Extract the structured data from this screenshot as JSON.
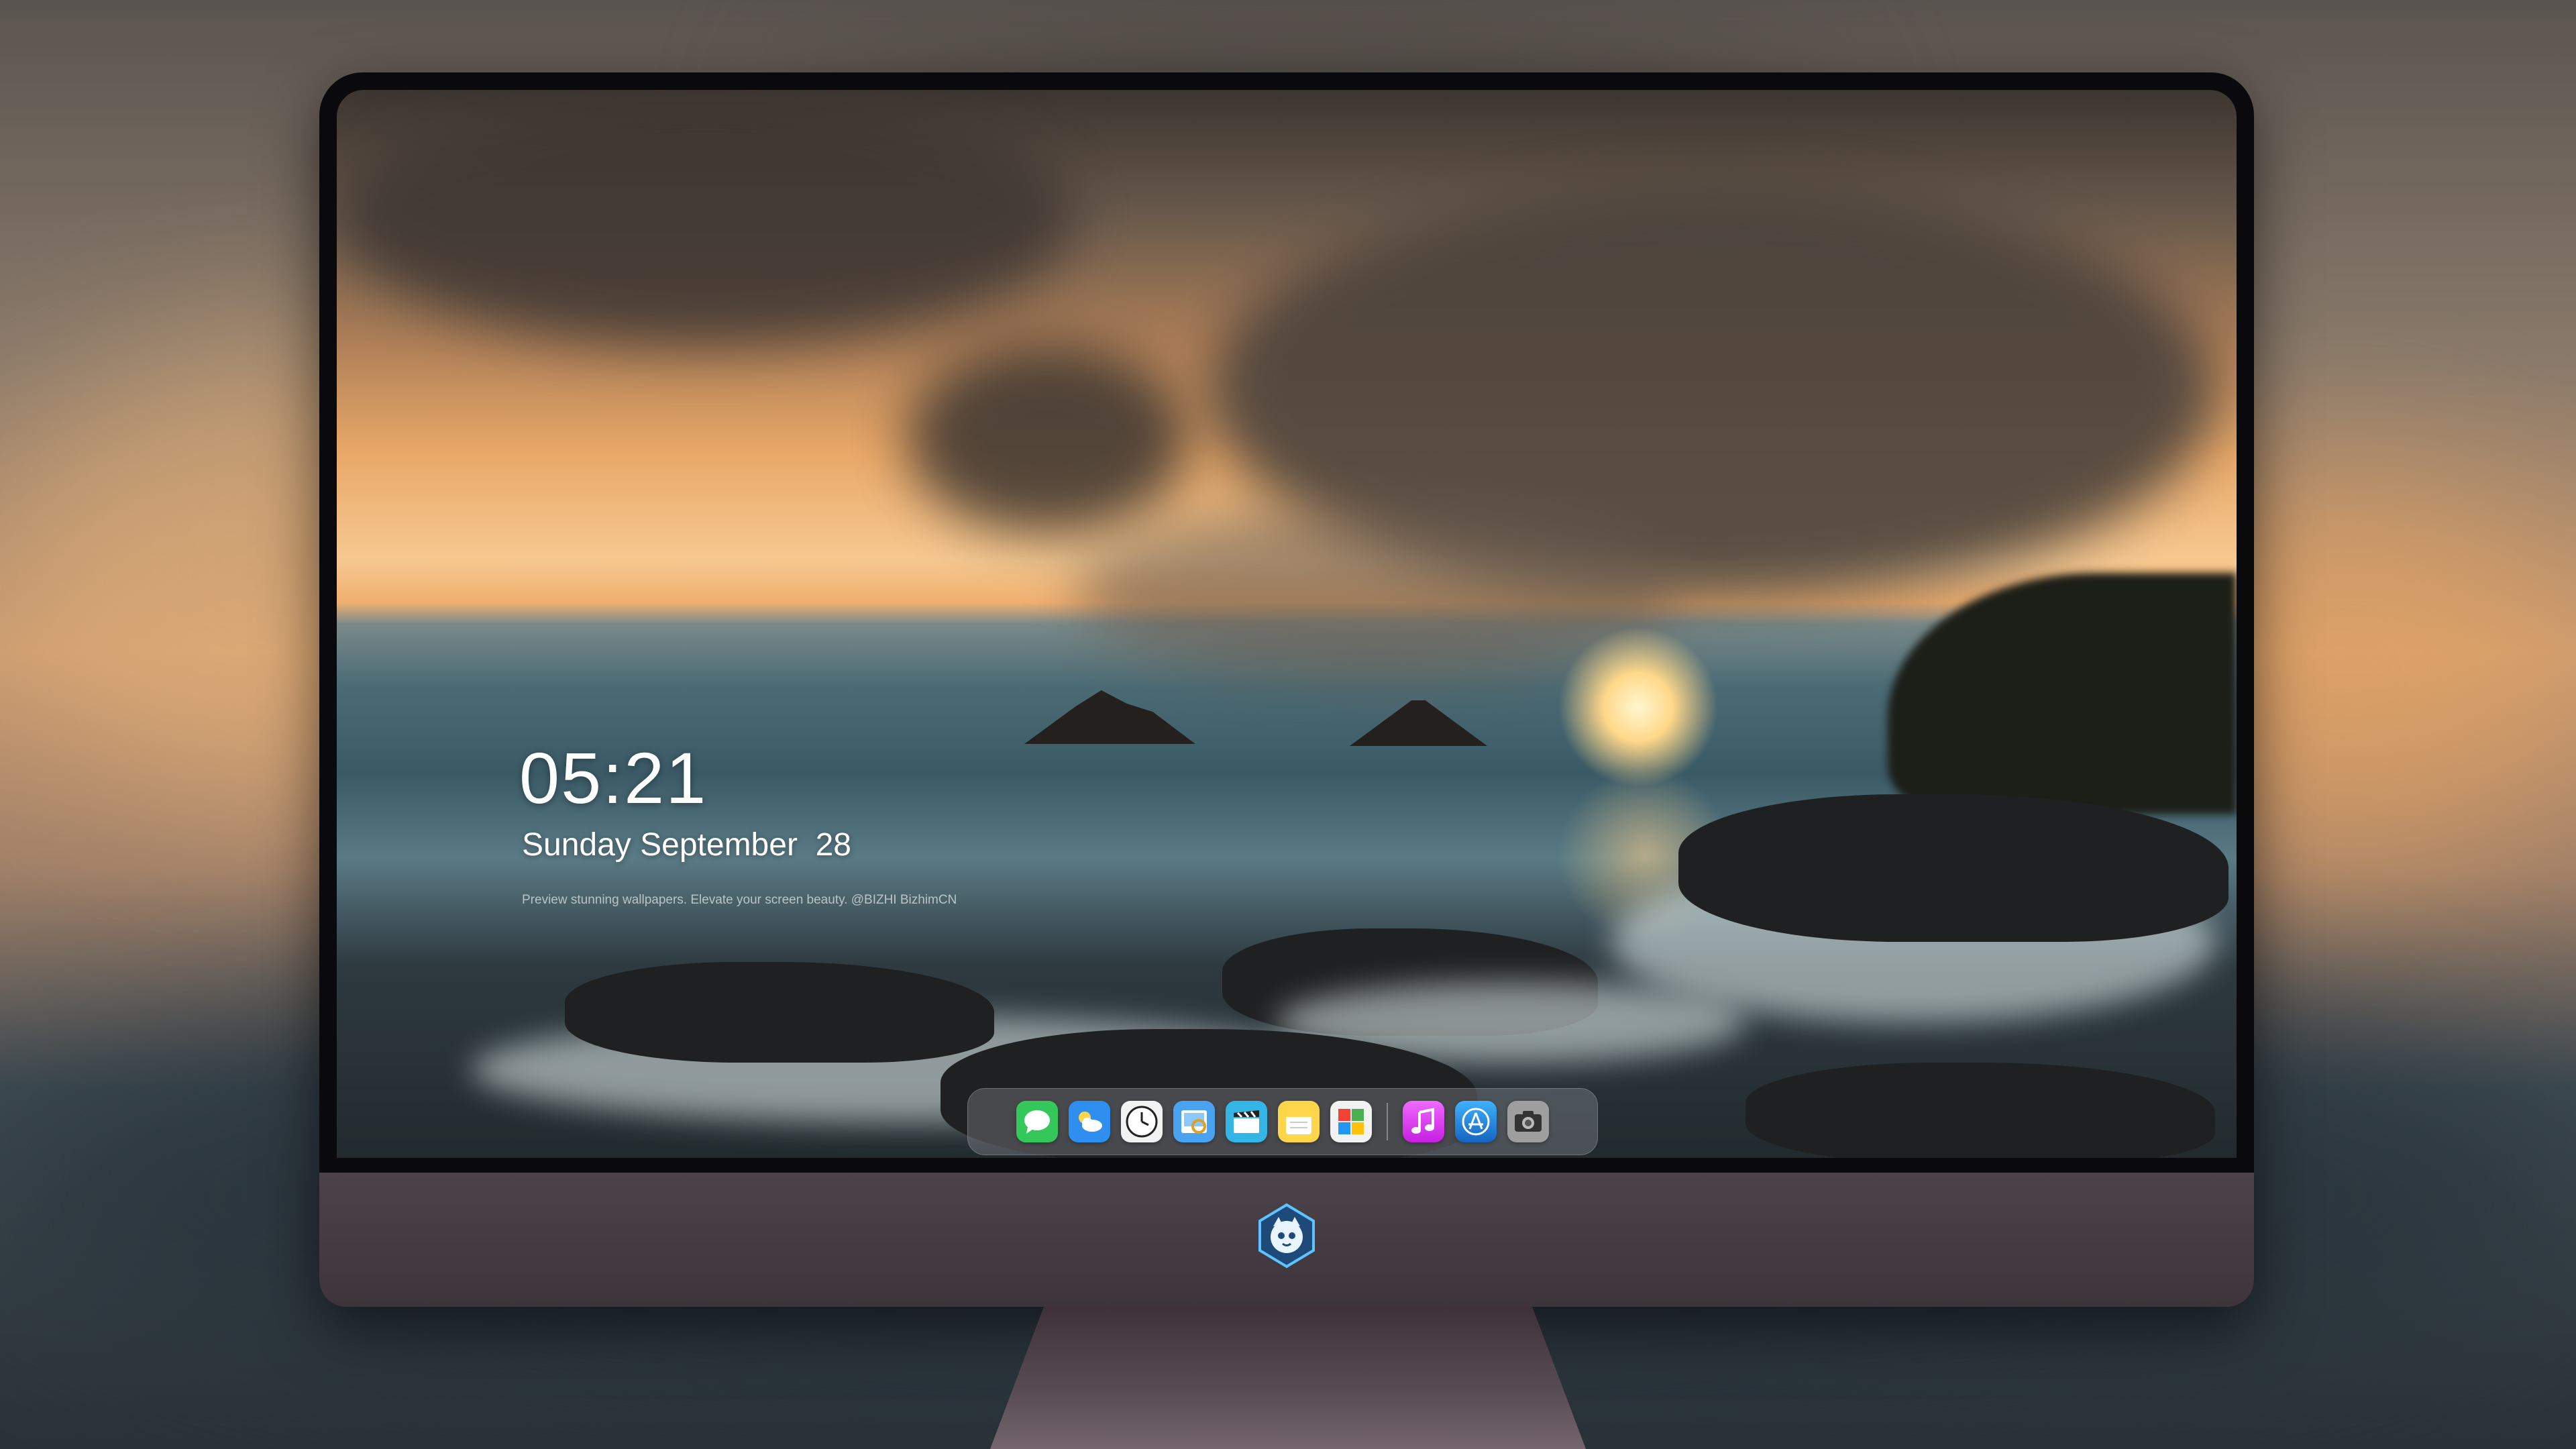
{
  "lockscreen": {
    "time": "05:21",
    "date": "Sunday September  28",
    "tagline": "Preview stunning wallpapers. Elevate your screen beauty. @BIZHI BizhimCN"
  },
  "dock": {
    "apps": [
      {
        "name": "Messages",
        "icon": "message-bubble-icon",
        "color": "#34c759"
      },
      {
        "name": "Weather",
        "icon": "weather-cloud-icon",
        "color": "#2f8ff0"
      },
      {
        "name": "Clock",
        "icon": "clock-icon",
        "color": "#f2f2f2"
      },
      {
        "name": "Preview",
        "icon": "preview-icon",
        "color": "#4aa3f0"
      },
      {
        "name": "Final Cut",
        "icon": "clapper-icon",
        "color": "#33b5e5"
      },
      {
        "name": "Notes",
        "icon": "notes-icon",
        "color": "#ffd54a"
      },
      {
        "name": "Photo Booth",
        "icon": "photos-grid-icon",
        "color": "#f2f2f2"
      },
      {
        "name": "Music",
        "icon": "music-note-icon",
        "color": "#e040fb"
      },
      {
        "name": "App Store",
        "icon": "app-store-icon",
        "color": "#1e88e5"
      },
      {
        "name": "Camera",
        "icon": "camera-icon",
        "color": "#9e9e9e"
      }
    ]
  },
  "colors": {
    "monitor_bezel": "#0a0a0c",
    "monitor_chin": "#4c424a",
    "text": "#ffffff"
  }
}
